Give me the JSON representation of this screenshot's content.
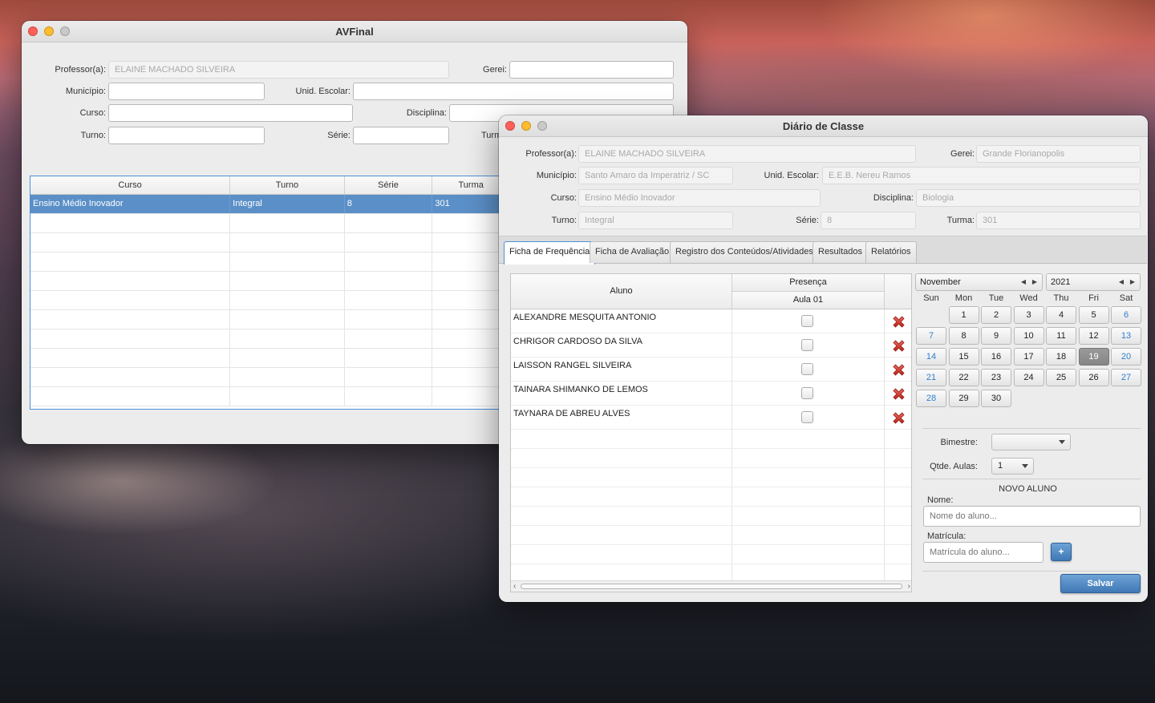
{
  "av_window": {
    "title": "AVFinal",
    "labels": {
      "professor": "Professor(a):",
      "gerei": "Gerei:",
      "municipio": "Município:",
      "unid_escolar": "Unid. Escolar:",
      "curso": "Curso:",
      "disciplina": "Disciplina:",
      "turno": "Turno:",
      "serie": "Série:",
      "turma": "Turm"
    },
    "professor_value": "ELAINE MACHADO SILVEIRA",
    "table": {
      "headers": [
        "Curso",
        "Turno",
        "Série",
        "Turma"
      ],
      "rows": [
        {
          "curso": "Ensino Médio Inovador",
          "turno": "Integral",
          "serie": "8",
          "turma": "301"
        }
      ]
    }
  },
  "diario_window": {
    "title": "Diário de Classe",
    "labels": {
      "professor": "Professor(a):",
      "gerei": "Gerei:",
      "municipio": "Município:",
      "unid_escolar": "Unid. Escolar:",
      "curso": "Curso:",
      "disciplina": "Disciplina:",
      "turno": "Turno:",
      "serie": "Série:",
      "turma": "Turma:"
    },
    "values": {
      "professor": "ELAINE MACHADO SILVEIRA",
      "gerei": "Grande Florianopolis",
      "municipio": "Santo Amaro da Imperatriz / SC",
      "unid_escolar": "E.E.B. Nereu Ramos",
      "curso": "Ensino Médio Inovador",
      "disciplina": "Biologia",
      "turno": "Integral",
      "serie": "8",
      "turma": "301"
    },
    "tabs": [
      {
        "label": "Ficha de Frequência",
        "active": true
      },
      {
        "label": "Ficha de Avaliação",
        "active": false
      },
      {
        "label": "Registro dos Conteúdos/Atividades",
        "active": false
      },
      {
        "label": "Resultados",
        "active": false
      },
      {
        "label": "Relatórios",
        "active": false
      }
    ],
    "grid": {
      "col_aluno": "Aluno",
      "col_presenca": "Presença",
      "col_aula": "Aula 01",
      "students": [
        "ALEXANDRE MESQUITA ANTONIO",
        "CHRIGOR CARDOSO DA SILVA",
        "LAISSON RANGEL SILVEIRA",
        "TAINARA SHIMANKO DE LEMOS",
        "TAYNARA DE ABREU ALVES"
      ],
      "delete_icon": "red-x-delete-icon"
    },
    "calendar": {
      "month": "November",
      "year": "2021",
      "weekdays": [
        "Sun",
        "Mon",
        "Tue",
        "Wed",
        "Thu",
        "Fri",
        "Sat"
      ],
      "first_weekday_index": 1,
      "days_in_month": 30,
      "selected_day": 19,
      "weekend_color": "#2f80d0"
    },
    "bimestre_label": "Bimestre:",
    "bimestre_value": "",
    "qtde_aulas_label": "Qtde. Aulas:",
    "qtde_aulas_value": "1",
    "novo_aluno": {
      "title": "NOVO ALUNO",
      "nome_label": "Nome:",
      "nome_placeholder": "Nome do aluno...",
      "matricula_label": "Matrícula:",
      "matricula_placeholder": "Matrícula do aluno...",
      "add_label": "+"
    },
    "salvar_label": "Salvar"
  }
}
